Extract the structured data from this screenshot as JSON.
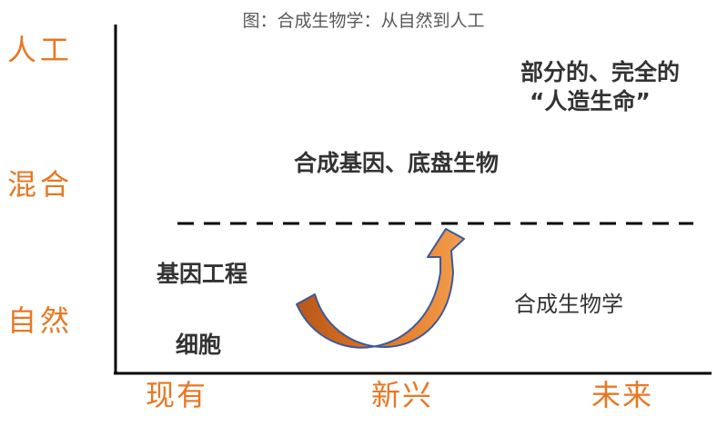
{
  "title": "图：合成生物学：从自然到人工",
  "y_levels": [
    "人工",
    "混合",
    "自然"
  ],
  "x_stages": [
    "现有",
    "新兴",
    "未来"
  ],
  "labels": {
    "artificial_line1": "部分的、完全的",
    "artificial_line2": "“人造生命”",
    "hybrid": "合成基因、底盘生物",
    "genetic_engineering": "基因工程",
    "cell": "细胞",
    "synthetic_biology": "合成生物学"
  },
  "colors": {
    "axis_label": "#e87722",
    "arrow_fill": "#e87722",
    "arrow_stroke": "#3b5a9a",
    "text": "#333333"
  }
}
